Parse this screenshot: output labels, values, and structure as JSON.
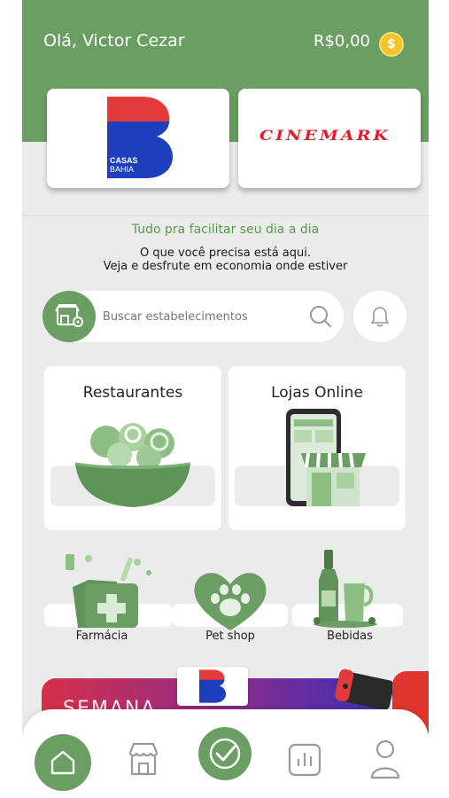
{
  "header": {
    "greeting": "Olá, Victor Cezar",
    "balance": "R$0,00",
    "coin_symbol": "$"
  },
  "partners": [
    {
      "name": "Casas Bahia",
      "logo_text": "CASAS BAHIA"
    },
    {
      "name": "Cinemark",
      "logo_text": "CINEMARK"
    }
  ],
  "intro": {
    "tagline": "Tudo pra facilitar seu dia a dia",
    "line1": "O que você precisa está aqui.",
    "line2": "Veja e desfrute em economia onde estiver"
  },
  "search": {
    "placeholder": "Buscar estabelecimentos"
  },
  "categories": {
    "restaurantes": "Restaurantes",
    "lojas_online": "Lojas Online",
    "farmacia": "Farmácia",
    "pet_shop": "Pet shop",
    "bebidas": "Bebidas"
  },
  "promo": {
    "text": "SEMANA"
  },
  "colors": {
    "brand_green": "#6a9e62",
    "background": "#ebebeb",
    "casas_bahia_blue": "#1d3fbd",
    "casas_bahia_red": "#e53a3a",
    "cinemark_red": "#e21b2d"
  },
  "icons": {
    "coin": "coin-icon",
    "store": "store-location-icon",
    "search": "search-icon",
    "bell": "bell-icon",
    "home": "home-icon",
    "shop": "shop-icon",
    "check": "check-icon",
    "chart": "bar-chart-icon",
    "user": "user-icon"
  }
}
